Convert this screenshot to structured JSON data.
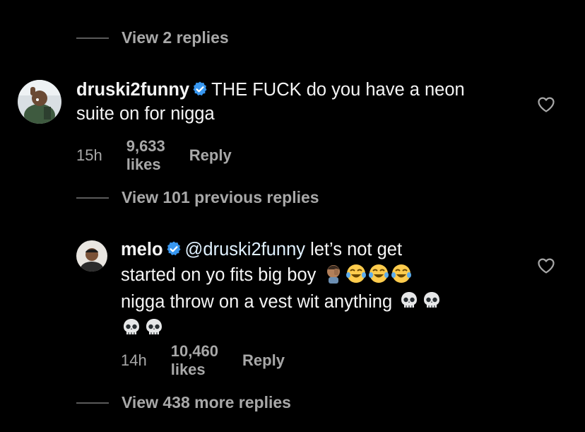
{
  "thread": {
    "view_replies_top": "View 2 replies",
    "view_previous": "View 101 previous replies",
    "view_more": "View 438 more replies"
  },
  "comment1": {
    "username": "druski2funny",
    "text_line1": "THE FUCK do you have a neon",
    "text_line2": "suite on for nigga",
    "time": "15h",
    "likes": "9,633 likes",
    "reply_label": "Reply",
    "icons": [
      "avatar",
      "verified-badge-icon",
      "heart-icon"
    ]
  },
  "comment2": {
    "username": "melo",
    "mention": "@druski2funny",
    "text_line1_rest": " let’s not get",
    "text_line2": "started on yo fits big boy",
    "text_line3": "nigga throw on a vest wit anything",
    "time": "14h",
    "likes": "10,460 likes",
    "reply_label": "Reply",
    "icons": [
      "avatar",
      "verified-badge-icon",
      "facepalm-emoji",
      "laughing-crying-emoji",
      "skull-emoji",
      "heart-icon"
    ]
  },
  "colors": {
    "background": "#000000",
    "text": "#f5f5f5",
    "muted": "#a8a8a8",
    "verified": "#3897f0"
  }
}
